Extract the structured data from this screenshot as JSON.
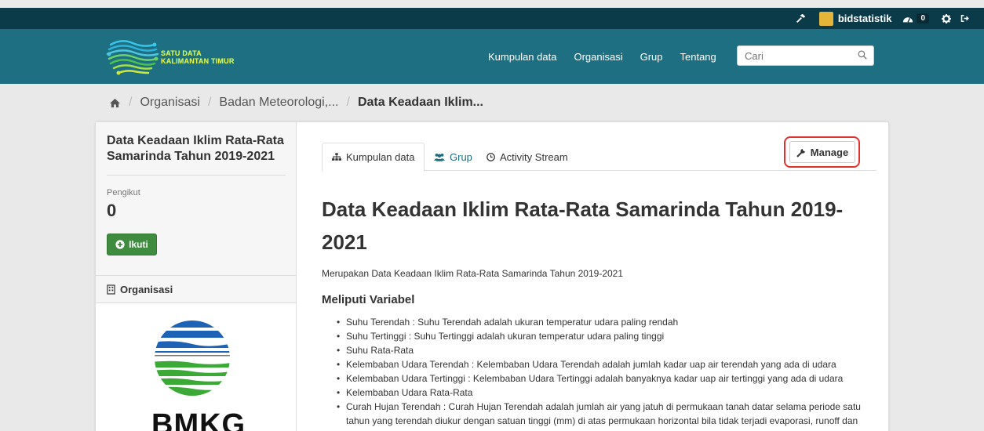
{
  "account": {
    "username": "bidstatistik",
    "dashboard_count": "0"
  },
  "header": {
    "logo_line1": "SATU DATA",
    "logo_line2": "KALIMANTAN TIMUR",
    "nav": [
      "Kumpulan data",
      "Organisasi",
      "Grup",
      "Tentang"
    ],
    "search_placeholder": "Cari"
  },
  "breadcrumb": {
    "items": [
      "Organisasi",
      "Badan Meteorologi,...",
      "Data Keadaan Iklim..."
    ]
  },
  "sidebar": {
    "title": "Data Keadaan Iklim Rata-Rata Samarinda Tahun 2019-2021",
    "followers_label": "Pengikut",
    "followers_count": "0",
    "follow_button": "Ikuti",
    "org_heading": "Organisasi",
    "org_logo_text": "BMKG"
  },
  "tabs": [
    {
      "label": "Kumpulan data",
      "icon": "sitemap-icon"
    },
    {
      "label": "Grup",
      "icon": "users-icon"
    },
    {
      "label": "Activity Stream",
      "icon": "clock-icon"
    }
  ],
  "manage_button": "Manage",
  "main": {
    "heading": "Data Keadaan Iklim Rata-Rata Samarinda Tahun 2019-2021",
    "description": "Merupakan Data Keadaan Iklim Rata-Rata Samarinda Tahun 2019-2021",
    "variables_heading": "Meliputi Variabel",
    "variables": [
      "Suhu Terendah : Suhu Terendah adalah ukuran temperatur udara paling rendah",
      "Suhu Tertinggi : Suhu Tertinggi adalah ukuran temperatur udara paling tinggi",
      "Suhu Rata-Rata",
      "Kelembaban Udara Terendah : Kelembaban Udara Terendah adalah jumlah kadar uap air terendah yang ada di udara",
      "Kelembaban Udara Tertinggi : Kelembaban Udara Tertinggi adalah banyaknya kadar uap air tertinggi yang ada di udara",
      "Kelembaban Udara Rata-Rata",
      "Curah Hujan Terendah : Curah Hujan Terendah adalah jumlah air yang jatuh di permukaan tanah datar selama periode satu tahun yang terendah diukur dengan satuan tinggi (mm) di atas permukaan horizontal bila tidak terjadi evaporasi, runoff dan infiltrasi"
    ]
  },
  "colors": {
    "topbar": "#0b3a48",
    "header": "#1e6f81",
    "follow_button": "#3f8b3f",
    "highlight_ring": "#e03131"
  }
}
